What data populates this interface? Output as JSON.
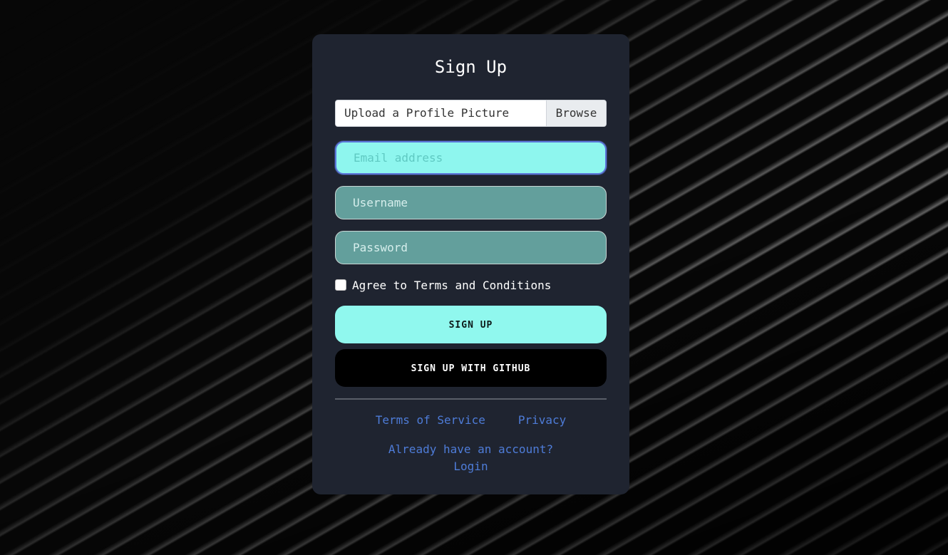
{
  "page": {
    "title": "Sign Up"
  },
  "form": {
    "file_upload_label": "Upload a Profile Picture",
    "file_browse_label": "Browse",
    "email_placeholder": "Email address",
    "email_value": "",
    "username_placeholder": "Username",
    "username_value": "",
    "password_placeholder": "Password",
    "password_value": "",
    "terms_label": "Agree to Terms and Conditions",
    "terms_checked": false,
    "signup_button": "SIGN UP",
    "github_button": "SIGN UP WITH GITHUB"
  },
  "footer": {
    "terms_link": "Terms of Service",
    "privacy_link": "Privacy",
    "account_question": "Already have an account?",
    "login_link": "Login"
  },
  "colors": {
    "card_background": "#1f2430",
    "field_background": "#639f9c",
    "field_focused_background": "#8ef6ee",
    "primary_button": "#90f8ee",
    "github_button": "#000000",
    "link": "#4e7cd8"
  }
}
